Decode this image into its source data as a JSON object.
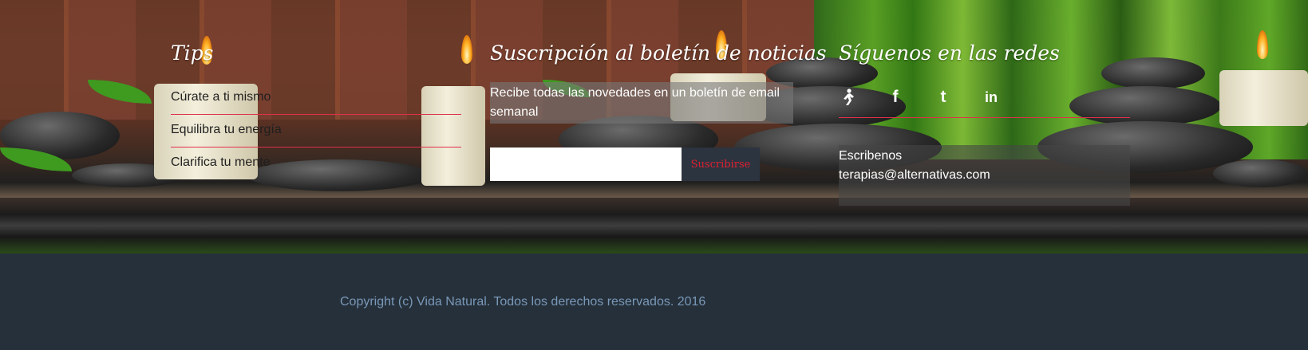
{
  "tips": {
    "title": "Tips",
    "items": [
      "Cúrate a ti mismo",
      "Equilibra tu energía",
      "Clarifica tu mente"
    ]
  },
  "newsletter": {
    "title": "Suscripción al boletín de noticias",
    "description": "Recibe todas las novedades en un boletín de email semanal",
    "email_value": "",
    "email_placeholder": "",
    "button_label": "Suscribirse"
  },
  "social": {
    "title": "Síguenos en las redes",
    "icons": [
      "runner-icon",
      "facebook-icon",
      "twitter-icon",
      "linkedin-icon"
    ],
    "contact_label": "Escribenos",
    "contact_email": "terapias@alternativas.com"
  },
  "footer": {
    "copyright": "Copyright (c) Vida Natural. Todos los derechos reservados. 2016"
  },
  "colors": {
    "accent": "#e0304a",
    "footer_bg": "#25303a",
    "copyright_text": "#7a98b8"
  }
}
